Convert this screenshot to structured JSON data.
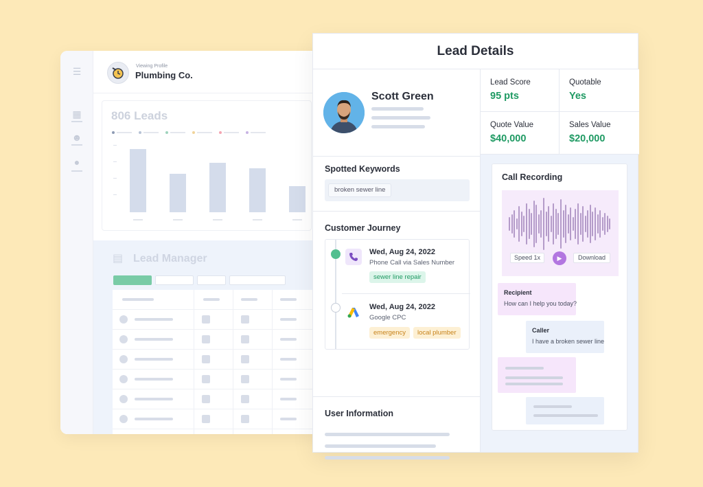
{
  "background_app": {
    "viewing_label": "Viewing Profile",
    "company_name": "Plumbing Co.",
    "leads_title": "806 Leads",
    "lead_manager_title": "Lead Manager",
    "legend_colors": [
      "#8e9bb4",
      "#b7c3d6",
      "#9fd3bd",
      "#f1d49a",
      "#f4a6b3",
      "#c7b3e3"
    ]
  },
  "lead_details": {
    "title": "Lead Details",
    "profile": {
      "name": "Scott Green"
    },
    "metrics": [
      {
        "label": "Lead Score",
        "value": "95 pts"
      },
      {
        "label": "Quotable",
        "value": "Yes"
      },
      {
        "label": "Quote Value",
        "value": "$40,000"
      },
      {
        "label": "Sales Value",
        "value": "$20,000"
      }
    ],
    "spotted_keywords": {
      "title": "Spotted Keywords",
      "keywords": [
        "broken sewer line"
      ]
    },
    "customer_journey": {
      "title": "Customer Journey",
      "events": [
        {
          "date": "Wed, Aug 24, 2022",
          "source": "Phone Call via Sales Number",
          "tags": [
            "sewer line repair"
          ],
          "icon": "phone-icon"
        },
        {
          "date": "Wed, Aug 24, 2022",
          "source": "Google CPC",
          "tags": [
            "emergency",
            "local plumber"
          ],
          "icon": "google-ads-icon"
        }
      ]
    },
    "user_information": {
      "title": "User Information"
    },
    "call_recording": {
      "title": "Call Recording",
      "speed_label": "Speed 1x",
      "download_label": "Download",
      "messages": [
        {
          "who": "Recipient",
          "text": "How can I help you today?"
        },
        {
          "who": "Caller",
          "text": "I have a broken sewer line"
        }
      ]
    }
  },
  "colors": {
    "accent_green": "#1f9a63",
    "accent_purple": "#b276e0",
    "page_background": "#fde9b8"
  }
}
